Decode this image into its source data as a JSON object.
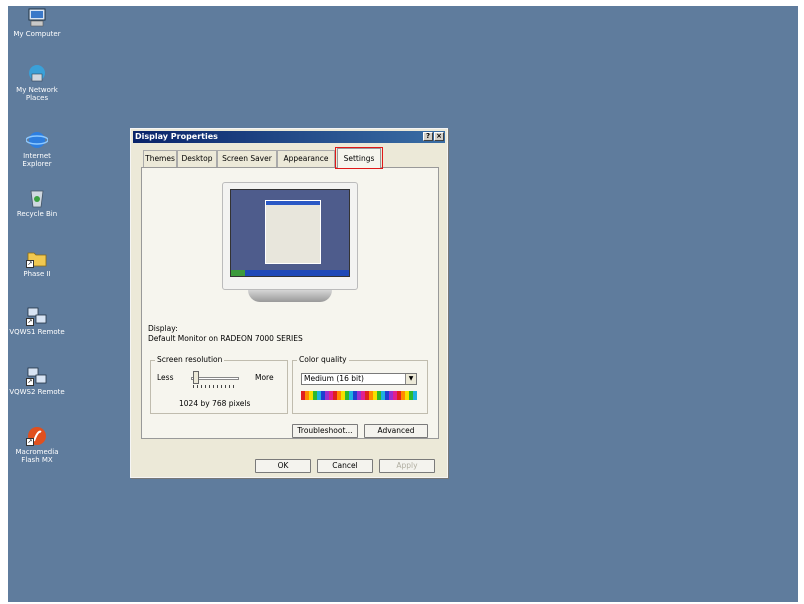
{
  "desktop_icons": [
    {
      "name": "my-computer",
      "label": "My Computer"
    },
    {
      "name": "my-network-places",
      "label": "My Network Places"
    },
    {
      "name": "internet-explorer",
      "label": "Internet Explorer"
    },
    {
      "name": "recycle-bin",
      "label": "Recycle Bin"
    },
    {
      "name": "phase-ii",
      "label": "Phase II"
    },
    {
      "name": "vqws1-remote",
      "label": "VQWS1 Remote"
    },
    {
      "name": "vqws2-remote",
      "label": "VQWS2 Remote"
    },
    {
      "name": "macromedia-flash-mx",
      "label": "Macromedia Flash MX"
    }
  ],
  "window": {
    "title": "Display Properties",
    "help_label": "?",
    "close_label": "×"
  },
  "tabs": [
    "Themes",
    "Desktop",
    "Screen Saver",
    "Appearance",
    "Settings"
  ],
  "active_tab": "Settings",
  "display": {
    "label": "Display:",
    "value": "Default Monitor on RADEON 7000 SERIES"
  },
  "screen_resolution": {
    "title": "Screen resolution",
    "less_label": "Less",
    "more_label": "More",
    "value": "1024 by 768 pixels",
    "slider_fraction": 0.12
  },
  "color_quality": {
    "title": "Color quality",
    "selected": "Medium (16 bit)"
  },
  "buttons": {
    "troubleshoot": "Troubleshoot...",
    "advanced": "Advanced",
    "ok": "OK",
    "cancel": "Cancel",
    "apply": "Apply"
  },
  "colors": {
    "desktop_bg": "#5f7c9d",
    "dialog_bg": "#ece9d8",
    "highlight": "#e01818"
  }
}
